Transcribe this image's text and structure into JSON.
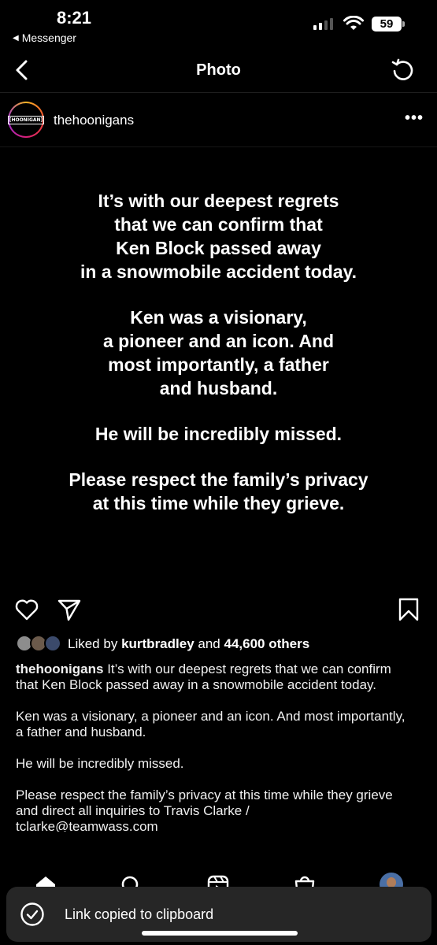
{
  "status_bar": {
    "time": "8:21",
    "back_app": "Messenger",
    "battery": "59"
  },
  "nav": {
    "title": "Photo"
  },
  "post": {
    "username": "thehoonigans",
    "avatar_logo": "[HOONIGAN]",
    "more_label": "•••",
    "image_text": {
      "p1": "It’s with our deepest regrets\nthat we can confirm that\nKen Block passed away\nin a snowmobile accident today.",
      "p2": "Ken was a visionary,\na pioneer and an icon. And\nmost importantly, a father\nand husband.",
      "p3": "He will be incredibly missed.",
      "p4": "Please respect the family’s privacy\nat this time while they grieve."
    },
    "likes": {
      "prefix": "Liked by",
      "user": "kurtbradley",
      "middle": "and",
      "others": "44,600 others"
    },
    "caption": {
      "user": "thehoonigans",
      "line1": "It’s with our deepest regrets that we can confirm that Ken Block passed away in a snowmobile accident today.",
      "line2": "Ken was a visionary, a pioneer and an icon. And most importantly, a father and husband.",
      "line3": "He will be incredibly missed.",
      "line4": "Please respect the family’s privacy at this time while they grieve and direct all inquiries to Travis Clarke /",
      "line5": "tclarke@teamwass.com"
    }
  },
  "toast": {
    "text": "Link copied to clipboard"
  },
  "icons": {
    "back": "chevron-left-icon",
    "refresh": "refresh-icon",
    "like": "heart-icon",
    "share": "send-icon",
    "save": "bookmark-icon",
    "home": "home-icon",
    "search": "search-icon",
    "reels": "reels-icon",
    "shop": "shop-icon",
    "toast": "check-circle-icon"
  }
}
